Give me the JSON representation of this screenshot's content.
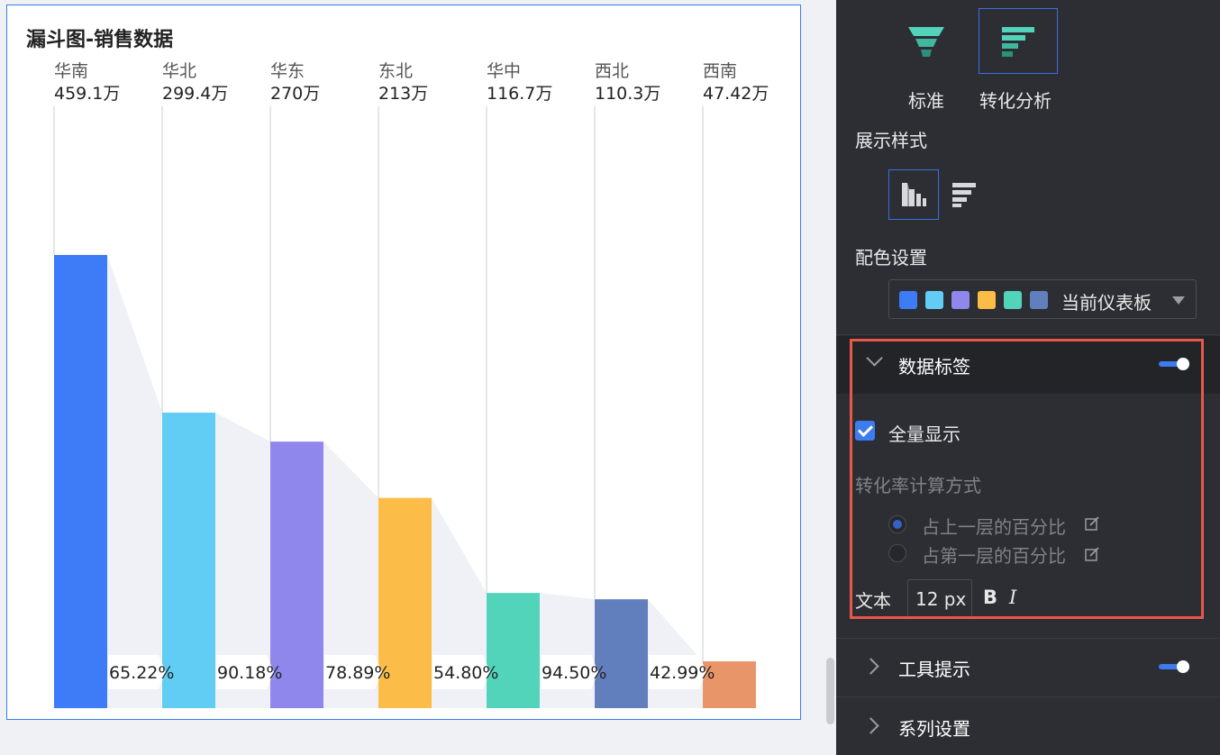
{
  "chart_data": {
    "type": "bar",
    "title": "漏斗图-销售数据",
    "categories": [
      "华南",
      "华北",
      "华东",
      "东北",
      "华中",
      "西北",
      "西南"
    ],
    "value_labels": [
      "459.1万",
      "299.4万",
      "270万",
      "213万",
      "116.7万",
      "110.3万",
      "47.42万"
    ],
    "values": [
      459.1,
      299.4,
      270,
      213,
      116.7,
      110.3,
      47.42
    ],
    "unit": "万",
    "conversion_rates": [
      "65.22%",
      "90.18%",
      "78.89%",
      "54.80%",
      "94.50%",
      "42.99%"
    ],
    "colors": [
      "#3d7bf7",
      "#61cdf5",
      "#8f87ec",
      "#fcbc48",
      "#52d4bb",
      "#627fbd",
      "#e8956a"
    ],
    "grid": false,
    "legend": "none"
  },
  "settings": {
    "chart_types": [
      {
        "label": "标准",
        "icon": "funnel-standard-icon",
        "selected": false
      },
      {
        "label": "转化分析",
        "icon": "funnel-conversion-icon",
        "selected": true
      }
    ],
    "display_style_heading": "展示样式",
    "display_styles": [
      {
        "icon": "bar-columns-icon",
        "selected": true
      },
      {
        "icon": "funnel-layers-icon",
        "selected": false
      }
    ],
    "color_heading": "配色设置",
    "palette": {
      "name": "当前仪表板",
      "swatches": [
        "#3d7bf7",
        "#61cdf5",
        "#8f87ec",
        "#fcbc48",
        "#52d4bb",
        "#627fbd"
      ]
    },
    "data_label": {
      "title": "数据标签",
      "enabled": true,
      "show_all_label": "全量显示",
      "show_all_checked": true,
      "rate_method_heading": "转化率计算方式",
      "rate_options": [
        {
          "label": "占上一层的百分比",
          "selected": true
        },
        {
          "label": "占第一层的百分比",
          "selected": false
        }
      ],
      "text_label": "文本",
      "font_size": "12 px",
      "bold_label": "B",
      "italic_label": "I"
    },
    "tooltip": {
      "title": "工具提示",
      "enabled": true
    },
    "series": {
      "title": "系列设置"
    }
  }
}
